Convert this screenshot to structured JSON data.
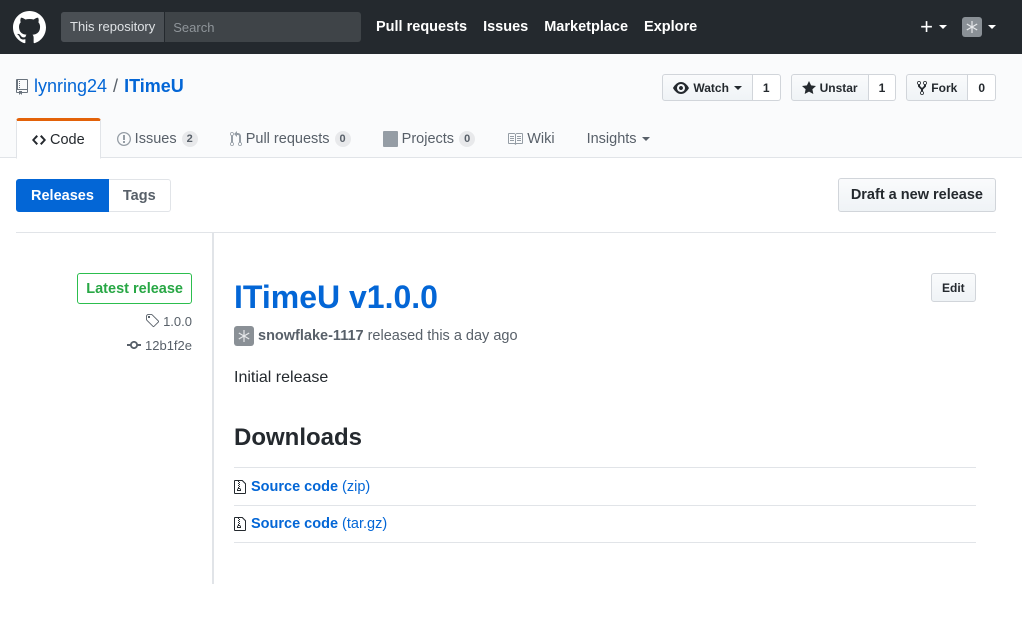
{
  "header": {
    "search_scope": "This repository",
    "search_placeholder": "Search",
    "nav": [
      "Pull requests",
      "Issues",
      "Marketplace",
      "Explore"
    ],
    "plus": "+"
  },
  "repo": {
    "owner": "lynring24",
    "separator": "/",
    "name": "ITimeU",
    "actions": {
      "watch_label": "Watch",
      "watch_count": "1",
      "star_label": "Unstar",
      "star_count": "1",
      "fork_label": "Fork",
      "fork_count": "0"
    },
    "tabs": [
      {
        "label": "Code"
      },
      {
        "label": "Issues",
        "count": "2"
      },
      {
        "label": "Pull requests",
        "count": "0"
      },
      {
        "label": "Projects",
        "count": "0"
      },
      {
        "label": "Wiki"
      },
      {
        "label": "Insights"
      }
    ]
  },
  "subnav": {
    "releases": "Releases",
    "tags": "Tags",
    "draft": "Draft a new release"
  },
  "release": {
    "latest_label": "Latest release",
    "tag": "1.0.0",
    "commit": "12b1f2e",
    "title": "ITimeU v1.0.0",
    "edit": "Edit",
    "author": "snowflake-1117",
    "released_text": "released this a day ago",
    "description": "Initial release",
    "downloads_heading": "Downloads",
    "downloads": [
      {
        "name": "Source code",
        "format": "(zip)"
      },
      {
        "name": "Source code",
        "format": "(tar.gz)"
      }
    ]
  },
  "colors": {
    "accent": "#0366d6",
    "header_bg": "#24292e",
    "latest_green": "#28a745",
    "tab_orange": "#e36209"
  }
}
